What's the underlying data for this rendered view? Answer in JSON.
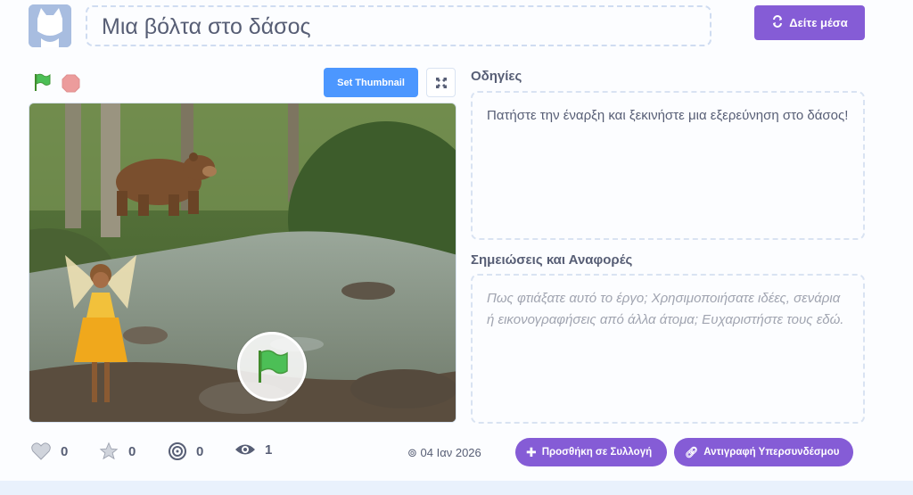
{
  "project": {
    "title": "Μια βόλτα στο δάσος",
    "see_inside_label": "Δείτε μέσα"
  },
  "player": {
    "set_thumbnail_label": "Set Thumbnail"
  },
  "instructions": {
    "heading": "Οδηγίες",
    "text": "Πατήστε την έναρξη και ξεκινήστε μια εξερεύνηση στο δάσος!"
  },
  "notes": {
    "heading": "Σημειώσεις και Αναφορές",
    "placeholder": "Πως φτιάξατε αυτό το έργο; Χρησιμοποιήσατε ιδέες, σενάρια ή εικονογραφήσεις από άλλα άτομα; Ευχαριστήστε τους εδώ."
  },
  "stats": {
    "loves": "0",
    "favorites": "0",
    "remixes": "0",
    "views": "1"
  },
  "date": "04 Ιαν 2026",
  "actions": {
    "add_to_studio": "Προσθήκη σε Συλλογή",
    "copy_link": "Αντιγραφή Υπερσυνδέσμου"
  },
  "colors": {
    "accent": "#855cd6",
    "blue": "#4c97ff",
    "text": "#575e75"
  }
}
